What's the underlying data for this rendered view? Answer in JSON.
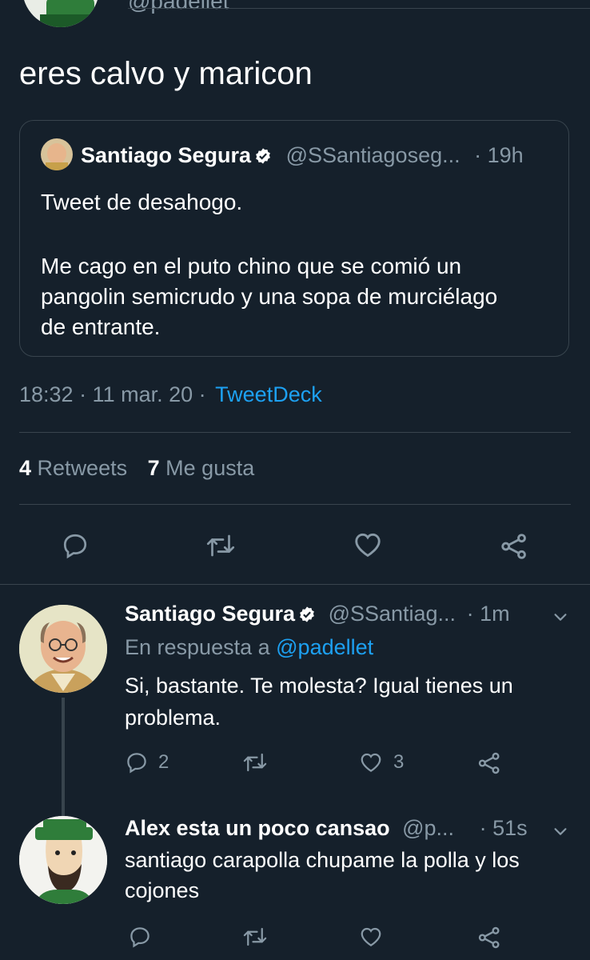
{
  "top": {
    "handle_fragment": "@padellet",
    "tweet_text": "eres calvo y maricon"
  },
  "quote": {
    "name": "Santiago Segura",
    "handle": "@SSantiagoseg...",
    "time": "· 19h",
    "line1": "Tweet de desahogo.",
    "line2": "Me cago en el puto chino que se comió un",
    "line3": "pangolin semicrudo y una sopa de murciélago",
    "line4": "de entrante."
  },
  "meta": {
    "time": "18:32 · 11 mar. 20 ·",
    "source": "TweetDeck"
  },
  "stats": {
    "retweets_count": "4",
    "retweets_label": "Retweets",
    "likes_count": "7",
    "likes_label": "Me gusta"
  },
  "reply1": {
    "name": "Santiago Segura",
    "handle": "@SSantiag...",
    "time": "· 1m",
    "reply_to_label": "En respuesta a",
    "reply_to_handle": "@padellet",
    "line1": "Si, bastante. Te molesta? Igual tienes un",
    "line2": "problema.",
    "reply_count": "2",
    "like_count": "3"
  },
  "reply2": {
    "name": "Alex esta un poco cansao",
    "handle": "@p...",
    "time": "· 51s",
    "line1": "santiago carapolla chupame la polla y los",
    "line2": "cojones"
  },
  "icons": {
    "reply": "reply-icon",
    "retweet": "retweet-icon",
    "like": "heart-icon",
    "share": "share-icon",
    "verified": "verified-badge-icon",
    "caret": "chevron-down-icon"
  },
  "colors": {
    "background": "#15202b",
    "muted": "#8899a6",
    "link": "#1da1f2",
    "divider": "#38444d"
  }
}
